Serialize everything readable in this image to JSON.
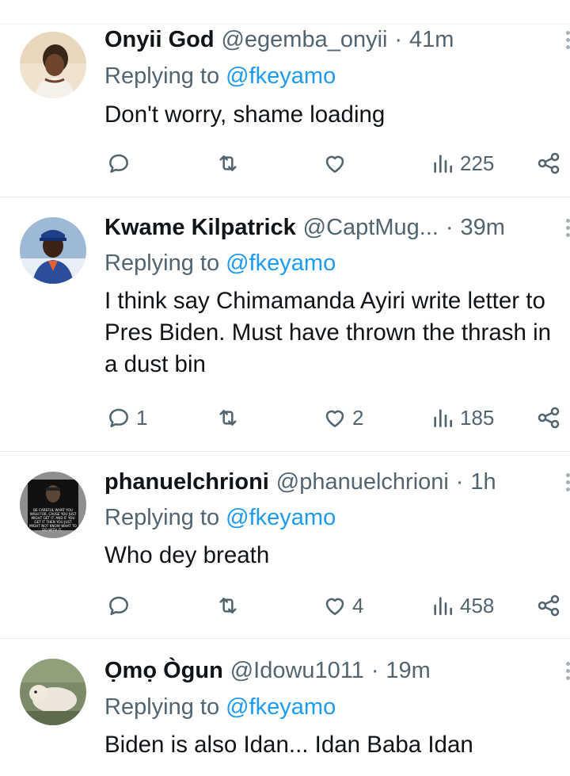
{
  "replies": [
    {
      "display_name": "Onyii God",
      "handle": "@egemba_onyii",
      "dot": "·",
      "time": "41m",
      "replying_prefix": "Replying to",
      "replying_to": "@fkeyamo",
      "text": "Don't worry, shame loading",
      "actions": {
        "reply_count": "",
        "retweet_count": "",
        "like_count": "",
        "view_count": "225"
      }
    },
    {
      "display_name": "Kwame Kilpatrick",
      "handle": "@CaptMug...",
      "dot": "·",
      "time": "39m",
      "replying_prefix": "Replying to",
      "replying_to": "@fkeyamo",
      "text": "I think say Chimamanda Ayiri write letter to Pres Biden. Must have thrown the thrash in a dust bin",
      "actions": {
        "reply_count": "1",
        "retweet_count": "",
        "like_count": "2",
        "view_count": "185"
      }
    },
    {
      "display_name": "phanuelchrioni",
      "handle": "@phanuelchrioni",
      "dot": "·",
      "time": "1h",
      "replying_prefix": "Replying to",
      "replying_to": "@fkeyamo",
      "text": "Who dey breath",
      "actions": {
        "reply_count": "",
        "retweet_count": "",
        "like_count": "4",
        "view_count": "458"
      },
      "avatar_caption": "BE CAREFUL WHAT YOU WISH FOR, CAUSE YOU JUST MIGHT GET IT. AND IF YOU GET IT THEN YOU JUST MIGHT NOT KNOW WHAT TO DO WITH IT..."
    },
    {
      "display_name": "Ọmọ Ògun",
      "handle": "@Idowu1011",
      "dot": "·",
      "time": "19m",
      "replying_prefix": "Replying to",
      "replying_to": "@fkeyamo",
      "text": "Biden is also Idan... Idan Baba Idan",
      "actions": {
        "reply_count": "",
        "retweet_count": "",
        "like_count": "",
        "view_count": ""
      }
    }
  ],
  "icons": {
    "reply": "reply-icon",
    "retweet": "retweet-icon",
    "like": "heart-icon",
    "views": "views-icon",
    "share": "share-icon",
    "more": "more-icon"
  },
  "colors": {
    "text": "#0f1419",
    "secondary": "#536471",
    "link": "#1d9bf0",
    "divider": "#e7e9ea"
  }
}
